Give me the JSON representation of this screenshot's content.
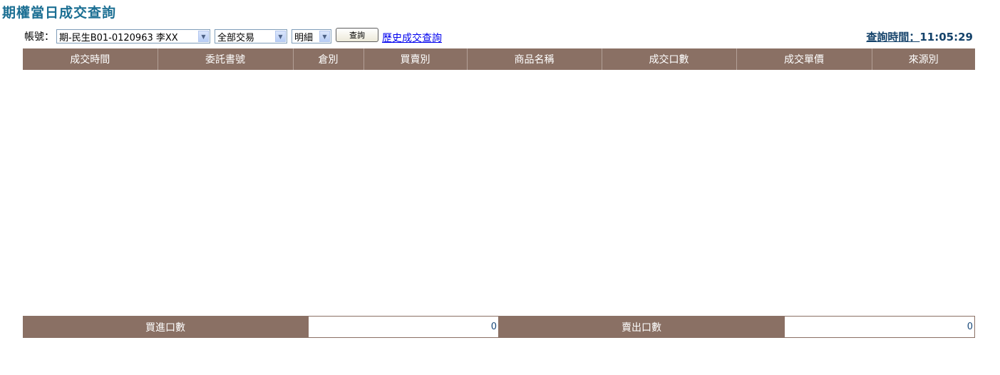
{
  "page": {
    "title": "期權當日成交查詢"
  },
  "toolbar": {
    "account_label": "帳號：",
    "account_value": "期-民生B01-0120963 李XX",
    "trade_type_value": "全部交易",
    "detail_value": "明細",
    "query_button_label": "查詢",
    "history_link_label": "歷史成交查詢"
  },
  "query_time": {
    "label": "查詢時間：",
    "value": "11:05:29"
  },
  "table": {
    "columns": [
      "成交時間",
      "委託書號",
      "倉別",
      "買賣別",
      "商品名稱",
      "成交口數",
      "成交單價",
      "來源別"
    ],
    "rows": []
  },
  "summary": {
    "buy_label": "買進口數",
    "buy_value": "0",
    "sell_label": "賣出口數",
    "sell_value": "0"
  }
}
